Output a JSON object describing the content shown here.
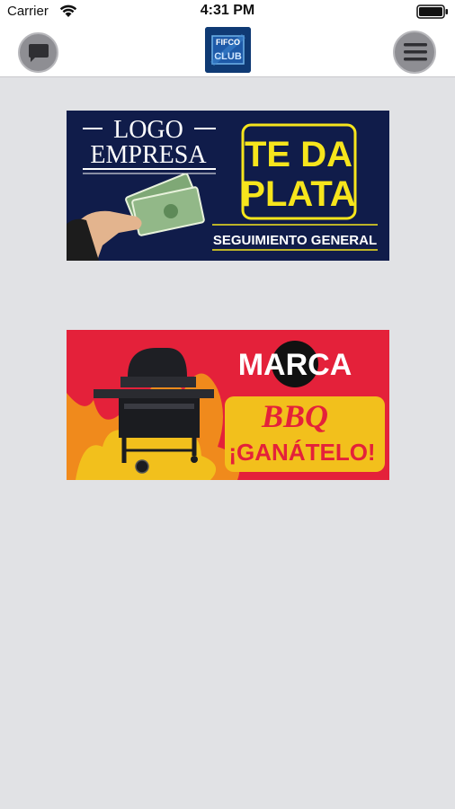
{
  "status_bar": {
    "carrier": "Carrier",
    "time": "4:31 PM"
  },
  "nav": {
    "logo_text_top": "FIFCO",
    "logo_text_bottom": "CLUB",
    "left_icon": "chat-bubble-icon",
    "right_icon": "hamburger-menu-icon"
  },
  "banners": [
    {
      "logo_line1": "LOGO",
      "logo_line2": "EMPRESA",
      "headline_line1": "TE DA",
      "headline_line2": "PLATA",
      "footer": "SEGUIMIENTO GENERAL",
      "bg_color": "#101c4a",
      "accent_color": "#f6e51c"
    },
    {
      "brand": "MARCA",
      "headline": "BBQ",
      "subheadline": "¡GANÁTELO!",
      "bg_color": "#e4213a",
      "accent_color": "#f2c01c"
    }
  ]
}
